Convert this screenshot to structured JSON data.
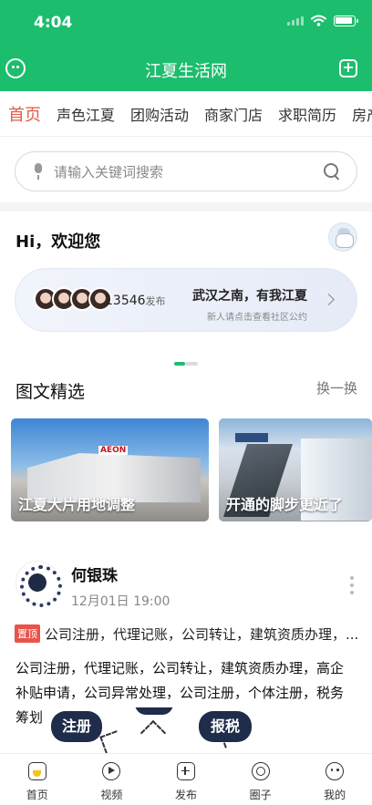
{
  "status_bar": {
    "time": "4:04"
  },
  "app_bar": {
    "title": "江夏生活网",
    "left_icon": "smiley-icon",
    "right_icon": "add-square-icon"
  },
  "tabs": [
    {
      "label": "首页",
      "active": true
    },
    {
      "label": "声色江夏",
      "active": false
    },
    {
      "label": "团购活动",
      "active": false
    },
    {
      "label": "商家门店",
      "active": false
    },
    {
      "label": "求职简历",
      "active": false
    },
    {
      "label": "房产",
      "active": false
    }
  ],
  "search": {
    "placeholder": "请输入关键词搜索"
  },
  "greeting": {
    "text": "Hi，欢迎您"
  },
  "banner": {
    "count": "13546",
    "count_suffix": "发布",
    "slogan": "武汉之南，有我江夏",
    "subtext": "新人请点击查看社区公约"
  },
  "section": {
    "title": "图文精选",
    "more": "换一换"
  },
  "cards": [
    {
      "caption": "江夏大片用地调整",
      "logo_text": "AEON"
    },
    {
      "caption": "开通的脚步更近了"
    }
  ],
  "post": {
    "author": "何银珠",
    "time": "12月01日 19:00",
    "pin_badge": "置顶",
    "pin_text": "公司注册，代理记账，公司转让，建筑资质办理，...",
    "body": "公司注册，代理记账，公司转让，建筑资质办理，高企补贴申请，公司异常处理，公司注册，个体注册，税务筹划",
    "image_labels": [
      "注册",
      "报税"
    ]
  },
  "bottom_nav": [
    {
      "label": "首页",
      "icon": "home-icon"
    },
    {
      "label": "视频",
      "icon": "video-icon"
    },
    {
      "label": "发布",
      "icon": "post-icon"
    },
    {
      "label": "圈子",
      "icon": "circle-icon"
    },
    {
      "label": "我的",
      "icon": "profile-icon"
    }
  ],
  "colors": {
    "brand": "#1dbd6e",
    "active_tab": "#e45a46",
    "pin_badge": "#e9534a"
  }
}
